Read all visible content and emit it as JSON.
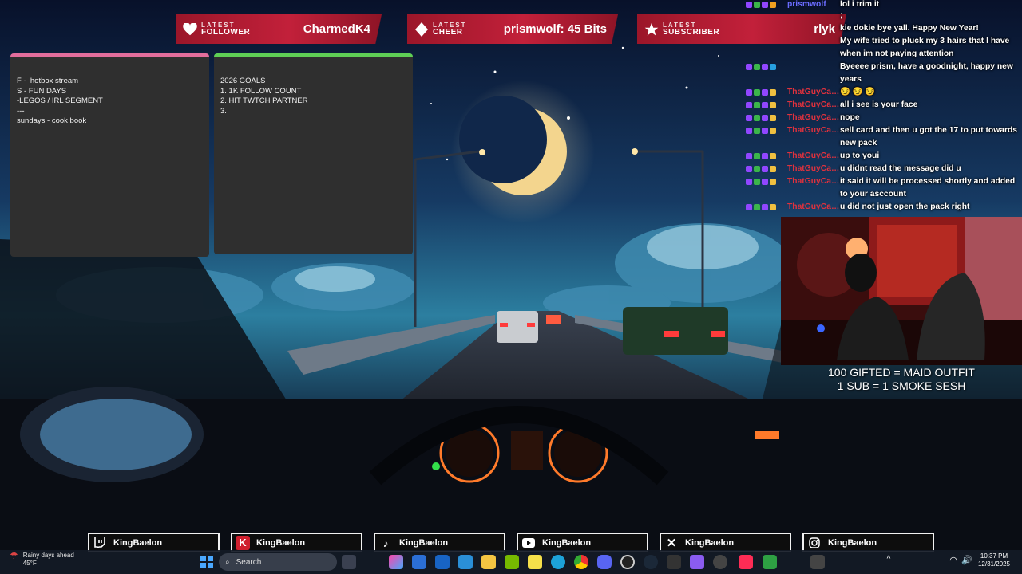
{
  "alerts": [
    {
      "tag": "LATEST",
      "type": "FOLLOWER",
      "value": "CharmedK4",
      "icon": "heart-icon"
    },
    {
      "tag": "LATEST",
      "type": "CHEER",
      "value": "prismwolf: 45 Bits",
      "icon": "diamond-icon"
    },
    {
      "tag": "LATEST",
      "type": "SUBSCRIBER",
      "value": "rlyk",
      "icon": "star-icon"
    }
  ],
  "notes": {
    "schedule": {
      "lines": [
        "F -  hotbox stream",
        "S - FUN DAYS",
        "-LEGOS / IRL SEGMENT",
        "---",
        "sundays - cook book"
      ]
    },
    "goals": {
      "lines": [
        "2026 GOALS",
        "1. 1K FOLLOW COUNT",
        "2. HIT TWTCH PARTNER",
        "3."
      ]
    }
  },
  "chat": [
    {
      "user": "prismwolf",
      "text": "lol i trim it",
      "color": "#6a6cff"
    },
    {
      "user": "",
      "text": ";",
      "color": "#6a6cff"
    },
    {
      "user": "",
      "text": "kie dokie bye yall. Happy New Year!",
      "color": "#6a6cff"
    },
    {
      "user": "",
      "text": "My wife tried to pluck my 3 hairs that I have when im not paying attention",
      "color": "#6a6cff"
    },
    {
      "user": "",
      "text": "Byeeee prism, have a goodnight, happy new years",
      "color": "#3b5bff"
    },
    {
      "user": "ThatGuyCal...",
      "text": "",
      "color": "#e0313d"
    },
    {
      "user": "ThatGuyCal...",
      "text": "all i see is your face",
      "color": "#e0313d"
    },
    {
      "user": "ThatGuyCal...",
      "text": "nope",
      "color": "#e0313d"
    },
    {
      "user": "ThatGuyCal...",
      "text": "sell card and then u got the 17 to put towards new pack",
      "color": "#e0313d"
    },
    {
      "user": "ThatGuyCal...",
      "text": "up to youi",
      "color": "#e0313d"
    },
    {
      "user": "ThatGuyCal...",
      "text": "u didnt read the message did u",
      "color": "#e0313d"
    },
    {
      "user": "ThatGuyCal...",
      "text": "it said it will be processed shortly and added to your asccount",
      "color": "#e0313d"
    },
    {
      "user": "ThatGuyCal...",
      "text": "u did not just open the pack right",
      "color": "#e0313d"
    }
  ],
  "cam_text": [
    "100 GIFTED = MAID OUTFIT",
    "1 SUB = 1 SMOKE SESH"
  ],
  "socials": [
    {
      "platform": "twitch-icon",
      "handle": "KingBaelon"
    },
    {
      "platform": "kick-icon",
      "handle": "KingBaelon"
    },
    {
      "platform": "tiktok-icon",
      "handle": "KingBaelon"
    },
    {
      "platform": "youtube-icon",
      "handle": "KingBaelon"
    },
    {
      "platform": "x-icon",
      "handle": "KingBaelon"
    },
    {
      "platform": "instagram-icon",
      "handle": "KingBaelon"
    }
  ],
  "taskbar": {
    "weather_title": "Rainy days ahead",
    "weather_temp": "45°F",
    "search_placeholder": "Search",
    "time": "10:37 PM",
    "date": "12/31/2025"
  }
}
